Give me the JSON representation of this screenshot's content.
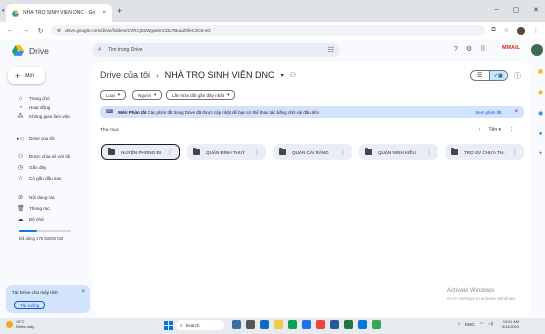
{
  "browser": {
    "tab_title": "NHÀ TRỌ SINH VIÊN DNC - Go",
    "url": "drive.google.com/drive/folders/1VRCj92Wgw6mCDLTBuuZ0feC3C5-sG"
  },
  "header": {
    "app_name": "Drive",
    "search_placeholder": "Tìm trong Drive",
    "gmail_label": "MAIL"
  },
  "sidebar": {
    "new_label": "Mới",
    "items": [
      {
        "icon": "home-icon",
        "label": "Trang chủ"
      },
      {
        "icon": "activity-icon",
        "label": "Hoạt động"
      },
      {
        "icon": "workspace-icon",
        "label": "Không gian làm việc"
      },
      {
        "icon": "my-drive-icon",
        "label": "Drive của tôi"
      },
      {
        "icon": "shared-icon",
        "label": "Được chia sẻ với tôi"
      },
      {
        "icon": "recent-icon",
        "label": "Gần đây"
      },
      {
        "icon": "star-icon",
        "label": "Có gắn dấu sao"
      },
      {
        "icon": "spam-icon",
        "label": "Nội dung rác"
      },
      {
        "icon": "trash-icon",
        "label": "Thùng rác"
      },
      {
        "icon": "cloud-icon",
        "label": "Bộ nhớ"
      }
    ],
    "storage_text": "Đã dùng 176 GB/50 GB",
    "storage_fraction": 0.35,
    "desktop_card": {
      "text": "Tải Drive cho máy tính",
      "button": "Tải xuống"
    }
  },
  "main": {
    "breadcrumb_parent": "Drive của tôi",
    "breadcrumb_current": "NHÀ TRỌ SINH VIÊN DNC",
    "filters": [
      "Loại",
      "Người",
      "Lần sửa đổi gần đây nhất"
    ],
    "banner_label": "Mới! Phím tắt",
    "banner_text": "Các phím tắt trong Drive đã được cập nhật để bạn có thể thao tác bằng chữ cái đầu tiên",
    "banner_link": "Xem phím tắt",
    "section_title": "Thư mục",
    "sort_label": "Tên",
    "folders": [
      "HUYỆN PHONG ĐI...",
      "QUẬN BÌNH THUỶ",
      "QUẬN CÁI RĂNG",
      "QUẬN NINH KIỀU",
      "TRỌ SV CHƯA TH..."
    ]
  },
  "watermark": {
    "title": "Activate Windows",
    "subtitle": "Go to Settings to activate Windows."
  },
  "taskbar": {
    "weather_temp": "19°C",
    "weather_desc": "Nhiều mây",
    "search_label": "Search",
    "lang": "ENG",
    "time": "10:51 AM",
    "date": "5/14/2024"
  },
  "colors": {
    "accent": "#0b57d0",
    "banner_bg": "#d3e3fd",
    "folder_bg": "#e9eef6"
  }
}
